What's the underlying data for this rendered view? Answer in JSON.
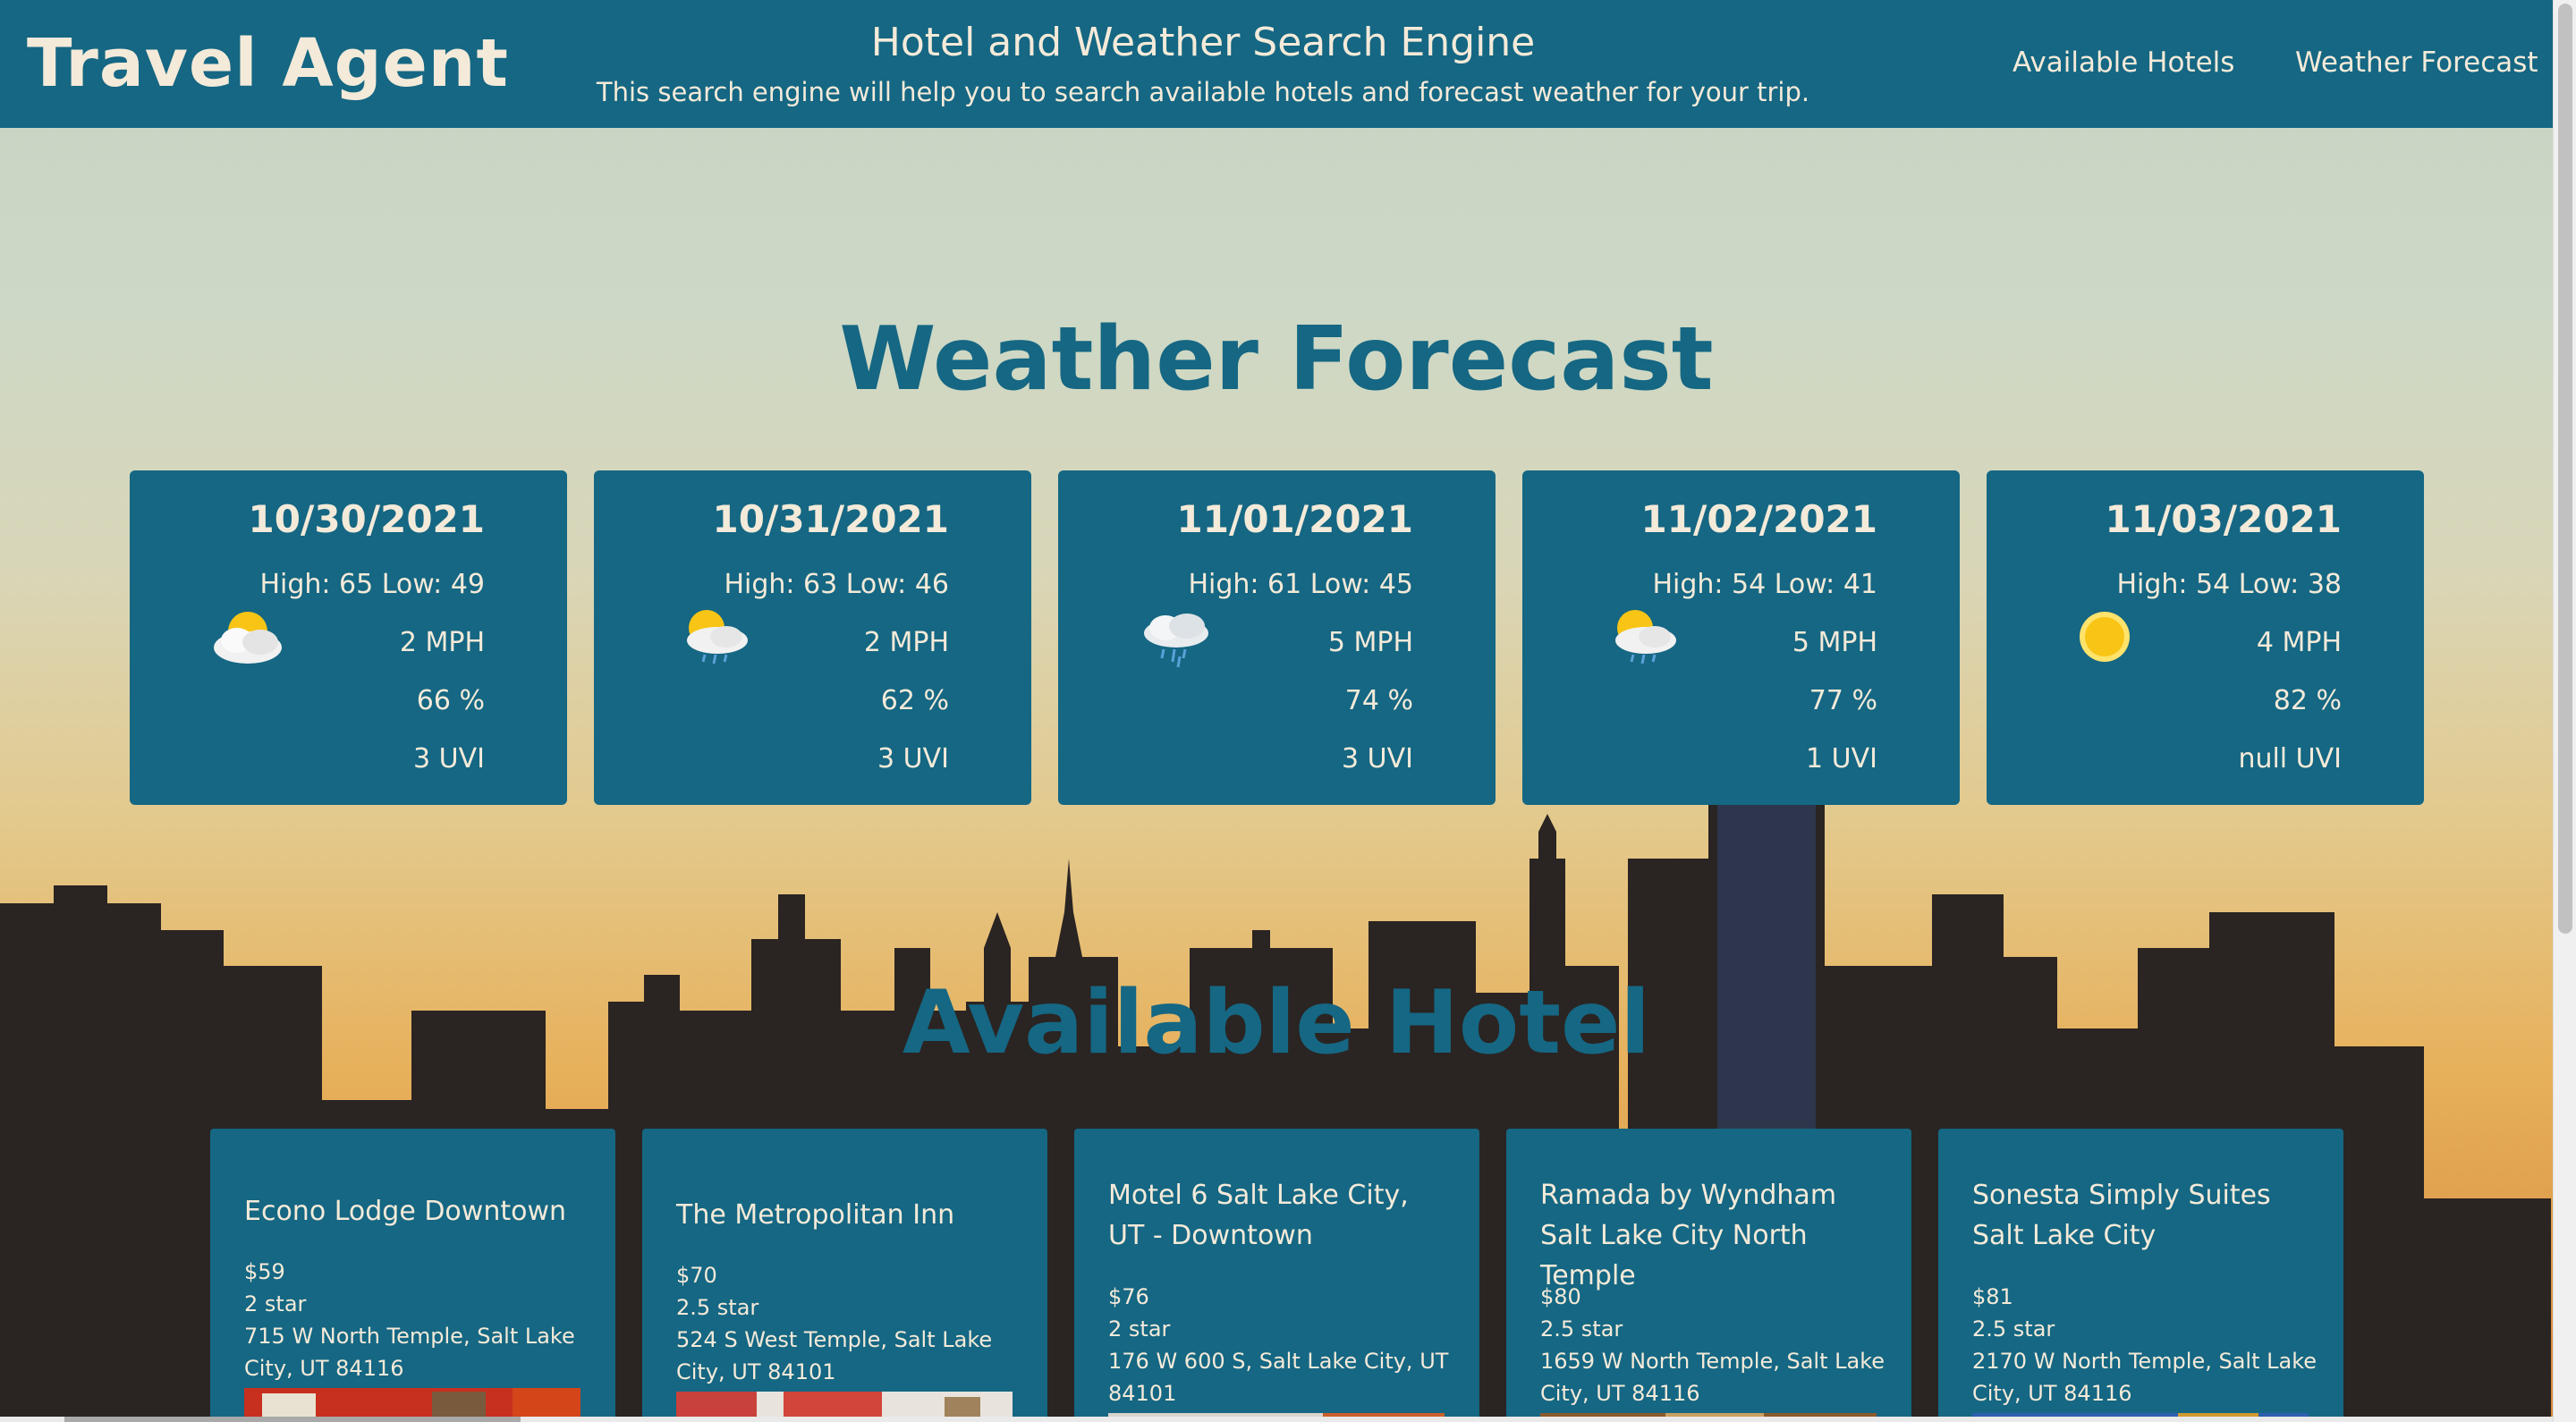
{
  "header": {
    "brand": "Travel Agent",
    "title": "Hotel and Weather Search Engine",
    "subtitle": "This search engine will help you to search available hotels and forecast weather for your trip.",
    "nav": [
      "Available Hotels",
      "Weather Forecast"
    ]
  },
  "weather": {
    "section_title": "Weather Forecast",
    "days": [
      {
        "date": "10/30/2021",
        "high_low": "High: 65 Low: 49",
        "wind": "2 MPH",
        "humidity": "66 %",
        "uvi": "3 UVI",
        "icon": "partly-cloudy-icon"
      },
      {
        "date": "10/31/2021",
        "high_low": "High: 63 Low: 46",
        "wind": "2 MPH",
        "humidity": "62 %",
        "uvi": "3 UVI",
        "icon": "sun-cloud-rain-icon"
      },
      {
        "date": "11/01/2021",
        "high_low": "High: 61 Low: 45",
        "wind": "5 MPH",
        "humidity": "74 %",
        "uvi": "3 UVI",
        "icon": "rain-cloud-icon"
      },
      {
        "date": "11/02/2021",
        "high_low": "High: 54 Low: 41",
        "wind": "5 MPH",
        "humidity": "77 %",
        "uvi": "1 UVI",
        "icon": "sun-cloud-rain-icon"
      },
      {
        "date": "11/03/2021",
        "high_low": "High: 54 Low: 38",
        "wind": "4 MPH",
        "humidity": "82 %",
        "uvi": "null UVI",
        "icon": "sun-icon"
      }
    ]
  },
  "hotels": {
    "section_title": "Available Hotel",
    "items": [
      {
        "name": "Econo Lodge Downtown",
        "price": "$59",
        "rating": "2 star",
        "address": "715 W North Temple, Salt Lake City, UT 84116"
      },
      {
        "name": "The Metropolitan Inn",
        "price": "$70",
        "rating": "2.5 star",
        "address": "524 S West Temple, Salt Lake City, UT 84101"
      },
      {
        "name": "Motel 6 Salt Lake City, UT - Downtown",
        "price": "$76",
        "rating": "2 star",
        "address": "176 W 600 S, Salt Lake City, UT 84101"
      },
      {
        "name": "Ramada by Wyndham Salt Lake City North Temple",
        "price": "$80",
        "rating": "2.5 star",
        "address": "1659 W North Temple, Salt Lake City, UT 84116"
      },
      {
        "name": "Sonesta Simply Suites Salt Lake City",
        "price": "$81",
        "rating": "2.5 star",
        "address": "2170 W North Temple, Salt Lake City, UT 84116"
      }
    ]
  },
  "colors": {
    "primary": "#156783",
    "text_light": "#f4ead9"
  }
}
